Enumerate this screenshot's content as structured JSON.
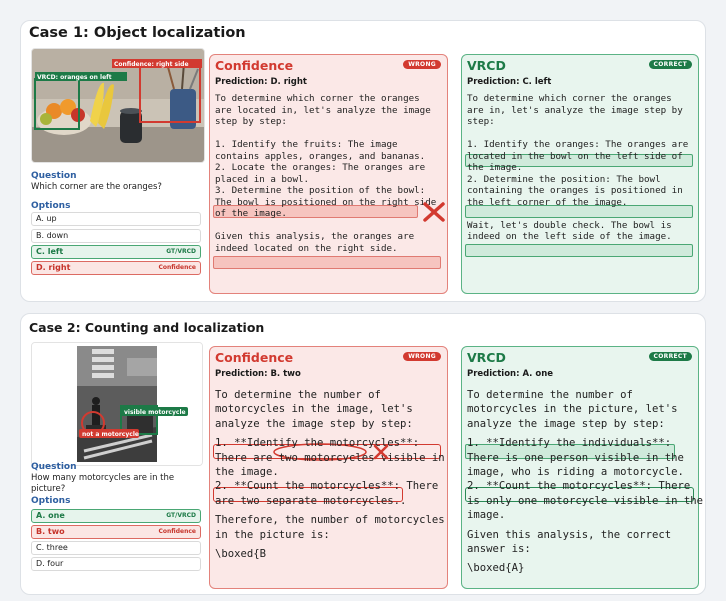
{
  "case1": {
    "title": "Case 1: Object localization",
    "image_labels": {
      "vrcd": "VRCD: oranges on left",
      "confidence": "Confidence: right side"
    },
    "question_label": "Question",
    "question": "Which corner are the oranges?",
    "options_label": "Options",
    "options": [
      {
        "text": "A. up",
        "tag": ""
      },
      {
        "text": "B. down",
        "tag": ""
      },
      {
        "text": "C. left",
        "tag": "GT/VRCD"
      },
      {
        "text": "D. right",
        "tag": "Confidence"
      }
    ],
    "confidence": {
      "title": "Confidence",
      "badge": "WRONG",
      "prediction": "Prediction: D. right",
      "lines": [
        "To determine which corner the oranges",
        "are located in, let's analyze the image",
        "step by step:",
        "",
        "1. Identify the fruits: The image",
        "contains apples, oranges, and bananas.",
        "2. Locate the oranges: The oranges are",
        "placed in a bowl.",
        "3. Determine the position of the bowl:",
        "The bowl is positioned on the right side",
        "of the image.",
        "",
        "Given this analysis, the oranges are",
        "indeed located on the right side."
      ]
    },
    "vrcd": {
      "title": "VRCD",
      "badge": "CORRECT",
      "prediction": "Prediction: C. left",
      "lines": [
        "To determine which corner the oranges",
        "are in, let's analyze the image step by",
        "step:",
        "",
        "1. Identify the oranges: The oranges are",
        "located in the bowl on the left side of",
        "the image.",
        "2. Determine the position: The bowl",
        "containing the oranges is positioned in",
        "the left corner of the image.",
        "",
        "Wait, let's double check. The bowl is",
        "indeed on the left side of the image."
      ]
    }
  },
  "case2": {
    "title": "Case 2: Counting and localization",
    "image_labels": {
      "visible": "visible motorcycle",
      "not": "not a motorcycle"
    },
    "question_label": "Question",
    "question_lines": [
      "How many motorcycles are in the",
      "picture?"
    ],
    "options_label": "Options",
    "options": [
      {
        "text": "A. one",
        "tag": "GT/VRCD"
      },
      {
        "text": "B. two",
        "tag": "Confidence"
      },
      {
        "text": "C. three",
        "tag": ""
      },
      {
        "text": "D. four",
        "tag": ""
      }
    ],
    "confidence": {
      "title": "Confidence",
      "badge": "WRONG",
      "prediction": "Prediction: B. two",
      "lines": [
        "To determine the number of",
        "motorcycles in the image, let's",
        "analyze the image step by step:",
        "",
        "1. **Identify the motorcycles**:",
        "There are two motorcycles visible in",
        "the image.",
        "2. **Count the motorcycles**: There",
        "are two separate motorcycles..",
        "",
        "Therefore, the number of motorcycles",
        "in the picture is:",
        "",
        "\\boxed{B"
      ]
    },
    "vrcd": {
      "title": "VRCD",
      "badge": "CORRECT",
      "prediction": "Prediction: A. one",
      "lines": [
        "To determine the number of",
        "motorcycles in the picture, let's",
        "analyze the image step by step:",
        "",
        "1. **Identify the individuals**:",
        "There is one person visible in the",
        "image, who is riding a motorcycle.",
        "2. **Count the motorcycles**: There",
        "is only one motorcycle visible in the",
        "image.",
        "",
        "Given this analysis, the correct",
        "answer is:",
        "",
        "\\boxed{A}"
      ]
    }
  }
}
